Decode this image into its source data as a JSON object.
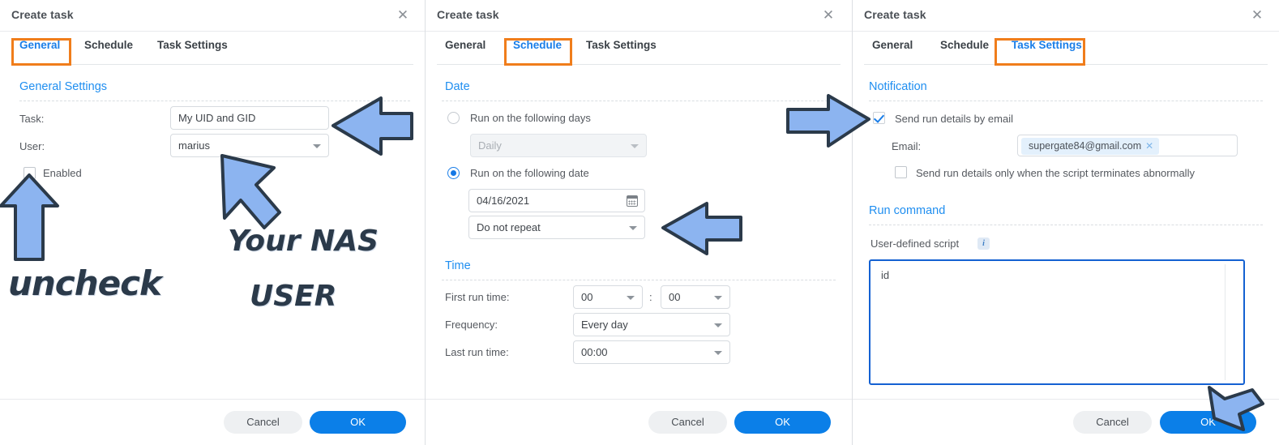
{
  "panels": [
    {
      "title": "Create task",
      "close_icon": "close-icon",
      "tabs": [
        {
          "label": "General",
          "active": true
        },
        {
          "label": "Schedule",
          "active": false
        },
        {
          "label": "Task Settings",
          "active": false
        }
      ],
      "section_title": "General Settings",
      "fields": {
        "task_label": "Task:",
        "task_value": "My UID and GID",
        "user_label": "User:",
        "user_value": "marius",
        "enabled_label": "Enabled",
        "enabled_checked": false
      }
    },
    {
      "title": "Create task",
      "close_icon": "close-icon",
      "tabs": [
        {
          "label": "General",
          "active": false
        },
        {
          "label": "Schedule",
          "active": true
        },
        {
          "label": "Task Settings",
          "active": false
        }
      ],
      "date_section": "Date",
      "time_section": "Time",
      "radio_days": "Run on the following days",
      "days_select": "Daily",
      "radio_date": "Run on the following date",
      "date_value": "04/16/2021",
      "repeat_value": "Do not repeat",
      "first_run_label": "First run time:",
      "first_run_hour": "00",
      "first_run_sep": ":",
      "first_run_minute": "00",
      "frequency_label": "Frequency:",
      "frequency_value": "Every day",
      "last_run_label": "Last run time:",
      "last_run_value": "00:00"
    },
    {
      "title": "Create task",
      "close_icon": "close-icon",
      "tabs": [
        {
          "label": "General",
          "active": false
        },
        {
          "label": "Schedule",
          "active": false
        },
        {
          "label": "Task Settings",
          "active": true
        }
      ],
      "notification_section": "Notification",
      "send_email_label": "Send run details by email",
      "send_email_checked": true,
      "email_label": "Email:",
      "email_chip": "supergate84@gmail.com",
      "chip_remove_icon": "close-icon",
      "abnormal_label": "Send run details only when the script terminates abnormally",
      "abnormal_checked": false,
      "run_command_section": "Run command",
      "script_label": "User-defined script",
      "info_icon": "info-icon",
      "script_value": "id"
    }
  ],
  "footer": {
    "cancel_label": "Cancel",
    "ok_label": "OK"
  },
  "annotations": {
    "uncheck_text": "uncheck",
    "nas_user_line1": "Your NAS",
    "nas_user_line2": "USER"
  },
  "colors": {
    "accent_blue": "#1a7ee8",
    "highlight_orange": "#f07d1b",
    "arrow_fill": "#8cb4f0",
    "arrow_stroke": "#2b3a4a",
    "ok_button": "#0b7fe8"
  }
}
